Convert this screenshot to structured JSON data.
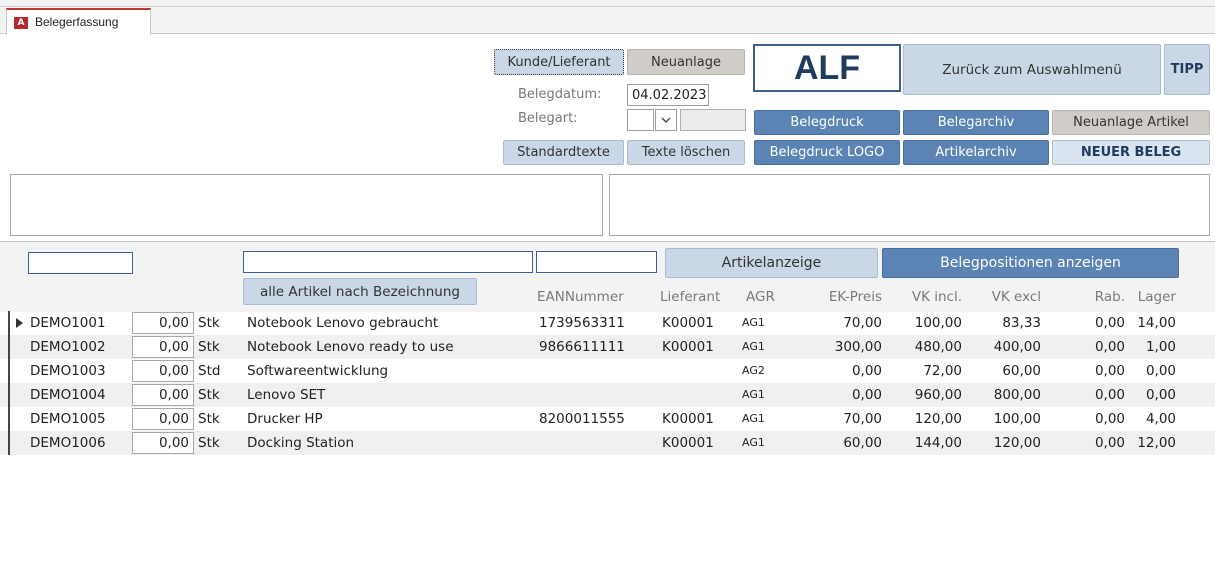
{
  "tab": {
    "label": "Belegerfassung",
    "icon": "access-app-icon",
    "icon_glyph": "A"
  },
  "header": {
    "kunde_lieferant_label": "Kunde/Lieferant",
    "neuanlage_label": "Neuanlage",
    "alf_label": "ALF",
    "zurueck_label": "Zurück zum Auswahlmenü",
    "tipp_label": "TIPP",
    "belegdatum_label": "Belegdatum:",
    "belegdatum_value": "04.02.2023",
    "belegart_label": "Belegart:",
    "belegart_value": "",
    "belegart_extra_value": "",
    "belegdruck_label": "Belegdruck",
    "belegarchiv_label": "Belegarchiv",
    "neuanlage_artikel_label": "Neuanlage Artikel",
    "standardtexte_label": "Standardtexte",
    "texte_loeschen_label": "Texte löschen",
    "belegdruck_logo_label": "Belegdruck LOGO",
    "artikelarchiv_label": "Artikelarchiv",
    "neuer_beleg_label": "NEUER BELEG"
  },
  "filters": {
    "artikelanzeige_label": "Artikelanzeige",
    "belegpositionen_label": "Belegpositionen anzeigen",
    "alle_artikel_label": "alle Artikel nach Bezeichnung"
  },
  "columns": {
    "ean": "EANNummer",
    "lieferant": "Lieferant",
    "agr": "AGR",
    "ek": "EK-Preis",
    "vk_incl": "VK incl.",
    "vk_excl": "VK excl",
    "rab": "Rab.",
    "lager": "Lager"
  },
  "rows": [
    {
      "nr": "DEMO1001",
      "menge": "0,00",
      "einheit": "Stk",
      "bez": "Notebook Lenovo gebraucht",
      "ean": "1739563311",
      "lief": "K00001",
      "agr": "AG1",
      "ek": "70,00",
      "vki": "100,00",
      "vke": "83,33",
      "rab": "0,00",
      "lager": "14,00"
    },
    {
      "nr": "DEMO1002",
      "menge": "0,00",
      "einheit": "Stk",
      "bez": "Notebook Lenovo ready to use",
      "ean": "9866611111",
      "lief": "K00001",
      "agr": "AG1",
      "ek": "300,00",
      "vki": "480,00",
      "vke": "400,00",
      "rab": "0,00",
      "lager": "1,00"
    },
    {
      "nr": "DEMO1003",
      "menge": "0,00",
      "einheit": "Std",
      "bez": "Softwareentwicklung",
      "ean": "",
      "lief": "",
      "agr": "AG2",
      "ek": "0,00",
      "vki": "72,00",
      "vke": "60,00",
      "rab": "0,00",
      "lager": "0,00"
    },
    {
      "nr": "DEMO1004",
      "menge": "0,00",
      "einheit": "Stk",
      "bez": "Lenovo SET",
      "ean": "",
      "lief": "",
      "agr": "AG1",
      "ek": "0,00",
      "vki": "960,00",
      "vke": "800,00",
      "rab": "0,00",
      "lager": "0,00"
    },
    {
      "nr": "DEMO1005",
      "menge": "0,00",
      "einheit": "Stk",
      "bez": "Drucker HP",
      "ean": "8200011555",
      "lief": "K00001",
      "agr": "AG1",
      "ek": "70,00",
      "vki": "120,00",
      "vke": "100,00",
      "rab": "0,00",
      "lager": "4,00"
    },
    {
      "nr": "DEMO1006",
      "menge": "0,00",
      "einheit": "Stk",
      "bez": "Docking Station",
      "ean": "",
      "lief": "K00001",
      "agr": "AG1",
      "ek": "60,00",
      "vki": "144,00",
      "vke": "120,00",
      "rab": "0,00",
      "lager": "12,00"
    }
  ],
  "colors": {
    "accent_blue": "#5b84b5",
    "light_blue": "#c9d7e6",
    "grey_button": "#d0cdc8",
    "alf_text": "#1f3b60"
  }
}
